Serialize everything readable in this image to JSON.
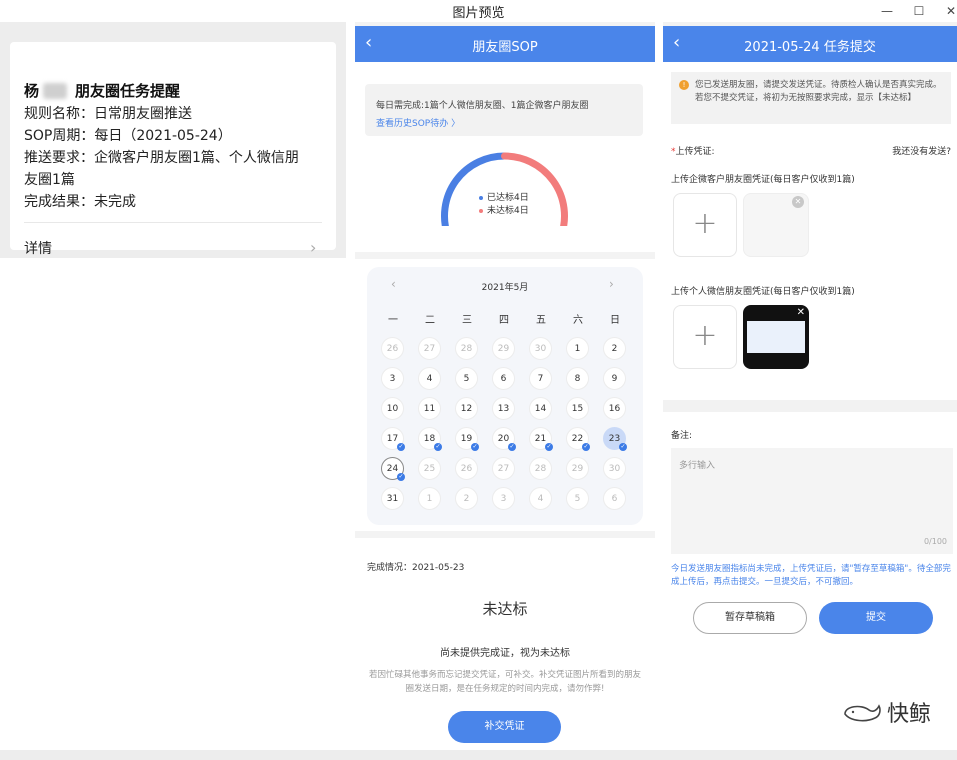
{
  "window": {
    "title": "图片预览"
  },
  "card": {
    "sender_initial": "杨",
    "title": "朋友圈任务提醒",
    "lines": [
      "规则名称：日常朋友圈推送",
      "SOP周期：每日（2021-05-24）",
      "推送要求：企微客户朋友圈1篇、个人微信朋",
      "友圈1篇",
      "完成结果：未完成"
    ],
    "detail_label": "详情"
  },
  "sop": {
    "nav_title": "朋友圈SOP",
    "notice": "每日需完成:1篇个人微信朋友圈、1篇企微客户朋友圈",
    "history_link": "查看历史SOP待办 〉",
    "gauge": {
      "reached": 4,
      "not_reached": 4,
      "reached_color": "#4a7fe3",
      "not_reached_color": "#f27c7c"
    },
    "legend_reached": "已达标4日",
    "legend_not_reached": "未达标4日",
    "calendar": {
      "month_label": "2021年5月",
      "weekdays": [
        "一",
        "二",
        "三",
        "四",
        "五",
        "六",
        "日"
      ],
      "rows": [
        [
          "26",
          "27",
          "28",
          "29",
          "30",
          "1",
          "2"
        ],
        [
          "3",
          "4",
          "5",
          "6",
          "7",
          "8",
          "9"
        ],
        [
          "10",
          "11",
          "12",
          "13",
          "14",
          "15",
          "16"
        ],
        [
          "17",
          "18",
          "19",
          "20",
          "21",
          "22",
          "23"
        ],
        [
          "24",
          "25",
          "26",
          "27",
          "28",
          "29",
          "30"
        ],
        [
          "31",
          "1",
          "2",
          "3",
          "4",
          "5",
          "6"
        ]
      ]
    },
    "completion_label": "完成情况：2021-05-23",
    "status": "未达标",
    "status_sub": "尚未提供完成证，视为未达标",
    "tip": "若因忙碌其他事务而忘记提交凭证，可补交。补交凭证图片所看到的朋友圈发送日期，是在任务规定的时间内完成，请勿作弊!",
    "supplement_button": "补交凭证"
  },
  "submit": {
    "nav_title": "2021-05-24 任务提交",
    "warning": "您已发送朋友圈，请提交发送凭证。待质检人确认是否真实完成。若您不提交凭证，将初为无按照要求完成，显示【未达标】",
    "required_star": "*",
    "upload_label": "上传凭证:",
    "not_sent": "我还没有发送?",
    "corp_label": "上传企微客户朋友圈凭证(每日客户仅收到1篇)",
    "personal_label": "上传个人微信朋友圈凭证(每日客户仅收到1篇)",
    "remark_label": "备注:",
    "remark_placeholder": "多行输入",
    "counter": "0/100",
    "hint": "今日发送朋友圈指标尚未完成，上传凭证后，请\"暂存至草稿箱\"。待全部完成上传后，再点击提交。一旦提交后，不可撤回。",
    "draft_button": "暂存草稿箱",
    "submit_button": "提交"
  },
  "watermark": {
    "text": "快鲸"
  },
  "colors": {
    "primary": "#4a85ea",
    "danger": "#e53935",
    "warning": "#f0a030"
  }
}
